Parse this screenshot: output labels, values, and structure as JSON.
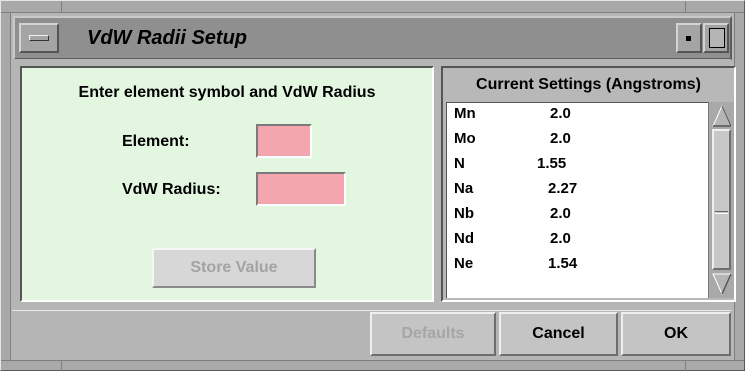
{
  "window": {
    "title": "VdW Radii Setup"
  },
  "entry": {
    "heading": "Enter element symbol and VdW Radius",
    "element_label": "Element:",
    "element_value": "",
    "radius_label": "VdW Radius:",
    "radius_value": "",
    "store_button": "Store Value",
    "field_color": "#f4a6ae",
    "panel_color": "#e2f6e0"
  },
  "settings": {
    "heading": "Current Settings (Angstroms)",
    "rows": [
      {
        "symbol": "Mn",
        "radius": "2.0"
      },
      {
        "symbol": "Mo",
        "radius": "2.0"
      },
      {
        "symbol": "N",
        "radius": "1.55"
      },
      {
        "symbol": "Na",
        "radius": "2.27"
      },
      {
        "symbol": "Nb",
        "radius": "2.0"
      },
      {
        "symbol": "Nd",
        "radius": "2.0"
      },
      {
        "symbol": "Ne",
        "radius": "1.54"
      }
    ]
  },
  "buttons": {
    "defaults": "Defaults",
    "cancel": "Cancel",
    "ok": "OK"
  },
  "icons": {
    "window_menu": "window-menu-icon",
    "minimize": "minimize-icon",
    "maximize": "maximize-icon",
    "scroll_up": "scroll-up-arrow-icon",
    "scroll_down": "scroll-down-arrow-icon"
  }
}
